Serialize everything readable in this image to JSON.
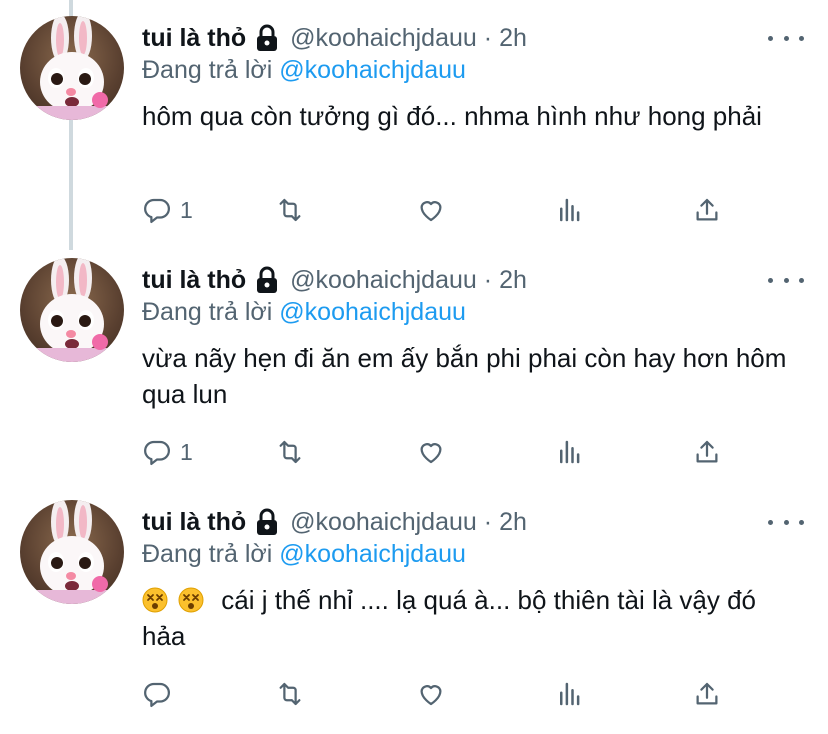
{
  "tweets": [
    {
      "display_name": "tui là thỏ",
      "handle": "@koohaichjdauu",
      "separator": "·",
      "time": "2h",
      "replying_label": "Đang trả lời",
      "replying_to": "@koohaichjdauu",
      "text": "hôm qua còn tưởng gì đó... nhma hình như hong phải",
      "reply_count": "1",
      "icons": [
        "lock-icon",
        "reply-icon",
        "retweet-icon",
        "like-icon",
        "stats-icon",
        "share-icon",
        "more-icon"
      ]
    },
    {
      "display_name": "tui là thỏ",
      "handle": "@koohaichjdauu",
      "separator": "·",
      "time": "2h",
      "replying_label": "Đang trả lời",
      "replying_to": "@koohaichjdauu",
      "text": "vừa nãy hẹn đi ăn em ấy bắn phi phai còn hay hơn hôm qua lun",
      "reply_count": "1",
      "icons": [
        "lock-icon",
        "reply-icon",
        "retweet-icon",
        "like-icon",
        "stats-icon",
        "share-icon",
        "more-icon"
      ]
    },
    {
      "display_name": "tui là thỏ",
      "handle": "@koohaichjdauu",
      "separator": "·",
      "time": "2h",
      "replying_label": "Đang trả lời",
      "replying_to": "@koohaichjdauu",
      "text": "cái j thế nhỉ .... lạ quá à... bộ thiên tài là vậy đó hảa",
      "reply_count": "",
      "emojis": [
        "dizzy-face-emoji",
        "dizzy-face-emoji"
      ],
      "icons": [
        "lock-icon",
        "reply-icon",
        "retweet-icon",
        "like-icon",
        "stats-icon",
        "share-icon",
        "more-icon"
      ]
    }
  ],
  "colors": {
    "text": "#0f1419",
    "muted": "#536471",
    "link": "#1d9bf0",
    "thread_line": "#cfd9de"
  }
}
